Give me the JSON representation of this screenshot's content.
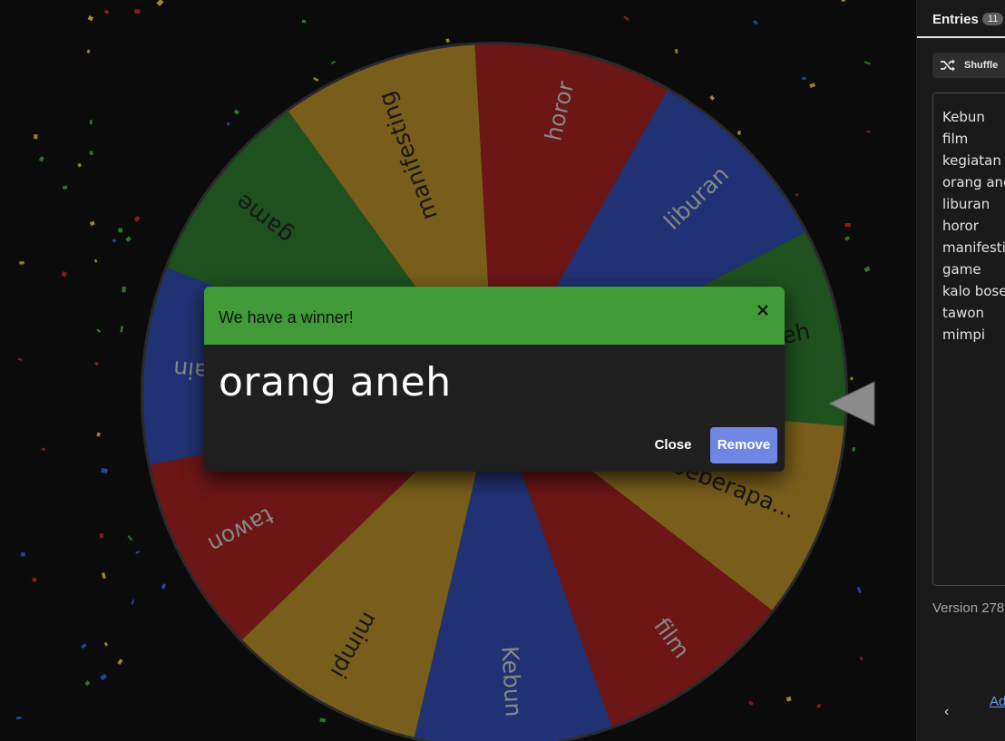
{
  "wheel": {
    "segments": [
      {
        "label": "kegiatan beberapa…",
        "color": "#8a6b1f"
      },
      {
        "label": "film",
        "color": "#7b1a1a"
      },
      {
        "label": "Kebun",
        "color": "#263a85"
      },
      {
        "label": "mimpi",
        "color": "#8a6b1f"
      },
      {
        "label": "tawon",
        "color": "#7b1a1a"
      },
      {
        "label": "kalo bosen ngapain",
        "color": "#263a85"
      },
      {
        "label": "game",
        "color": "#245d24"
      },
      {
        "label": "manifesting",
        "color": "#8a6b1f"
      },
      {
        "label": "horor",
        "color": "#7b1a1a"
      },
      {
        "label": "liburan",
        "color": "#263a85"
      },
      {
        "label": "orang aneh",
        "color": "#245d24"
      }
    ]
  },
  "dialog": {
    "title": "We have a winner!",
    "winner": "orang aneh",
    "close_label": "Close",
    "remove_label": "Remove",
    "header_color": "#3f9a37",
    "remove_color": "#6f87e3"
  },
  "panel": {
    "tab_label": "Entries",
    "entry_count": "11",
    "shuffle_label": "Shuffle",
    "entries": [
      "Kebun",
      "film",
      "kegiatan beberapa…",
      "orang aneh",
      "liburan",
      "horor",
      "manifesting",
      "game",
      "kalo bosen ngapain",
      "tawon",
      "mimpi"
    ],
    "version_text": "Version 278",
    "advanced_label": "Advanced"
  }
}
